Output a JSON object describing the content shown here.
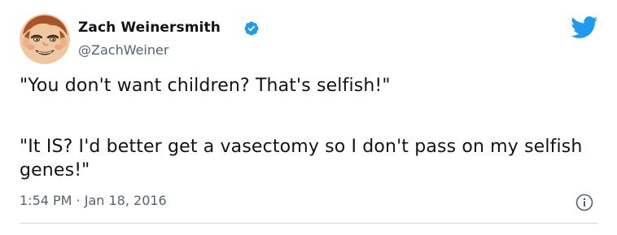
{
  "tweet": {
    "author": {
      "name": "Zach Weinersmith",
      "handle": "@ZachWeiner",
      "verified": true,
      "avatar_icon": "cartoon-face-avatar"
    },
    "text": {
      "line1": "\"You don't want children? That's selfish!\"",
      "line2": "\"It IS? I'd better get a vasectomy so I don't pass on my selfish genes!\""
    },
    "timestamp": "1:54 PM · Jan 18, 2016",
    "icons": {
      "brand": "twitter-bird-icon",
      "verified": "verified-badge-icon",
      "info": "info-icon"
    },
    "colors": {
      "brand": "#1d9bf0",
      "text": "#0f1419",
      "secondary": "#536471",
      "divider": "#cfd9de"
    }
  }
}
